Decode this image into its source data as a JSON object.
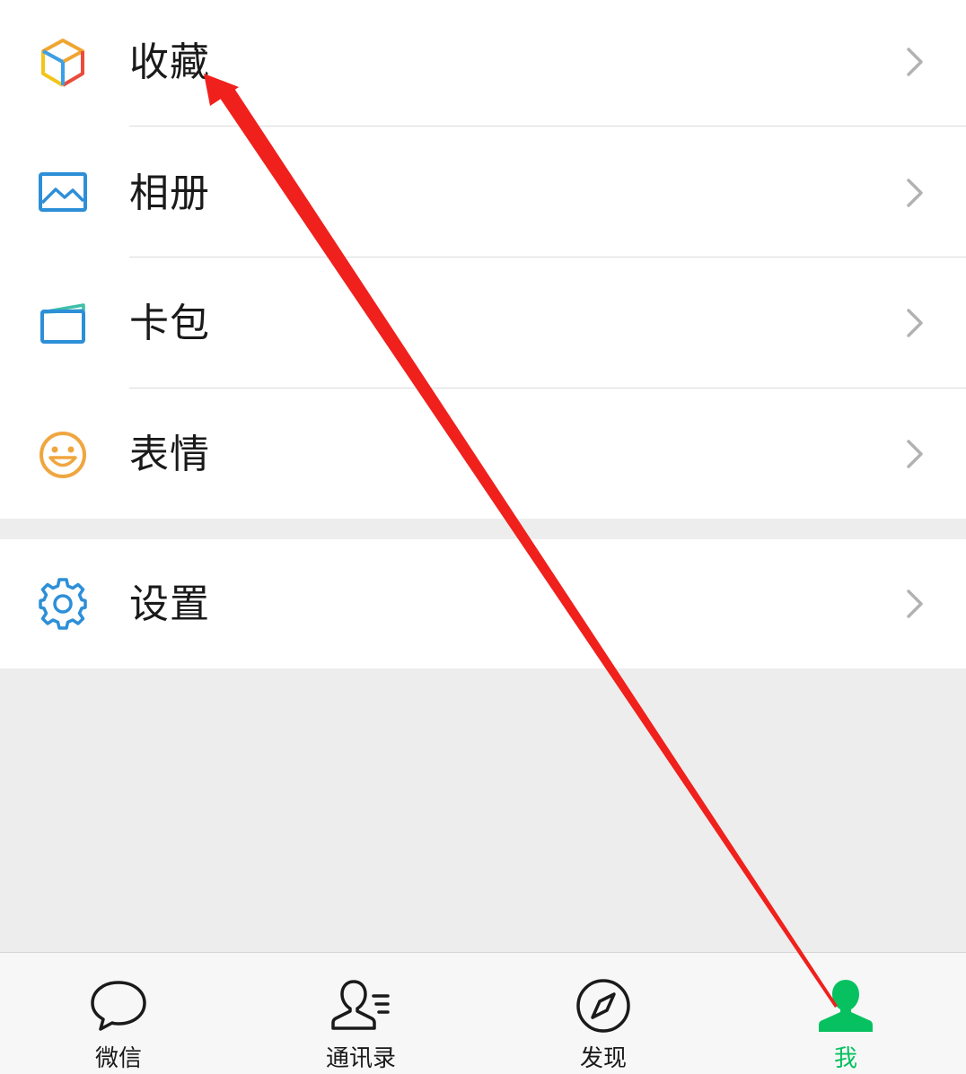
{
  "menu_groups": [
    {
      "items": [
        {
          "label": "收藏",
          "icon": "favorites-cube-icon"
        },
        {
          "label": "相册",
          "icon": "album-picture-icon"
        },
        {
          "label": "卡包",
          "icon": "card-wallet-icon"
        },
        {
          "label": "表情",
          "icon": "sticker-smiley-icon"
        }
      ]
    },
    {
      "items": [
        {
          "label": "设置",
          "icon": "gear-icon"
        }
      ]
    }
  ],
  "tabbar": {
    "active_index": 3,
    "items": [
      {
        "label": "微信",
        "icon": "chat-bubble-icon"
      },
      {
        "label": "通讯录",
        "icon": "contacts-icon"
      },
      {
        "label": "发现",
        "icon": "compass-icon"
      },
      {
        "label": "我",
        "icon": "person-icon"
      }
    ]
  },
  "colors": {
    "active_tab": "#07c160",
    "annotation_arrow": "#f0201c",
    "page_background": "#ededed",
    "card_background": "#ffffff"
  }
}
